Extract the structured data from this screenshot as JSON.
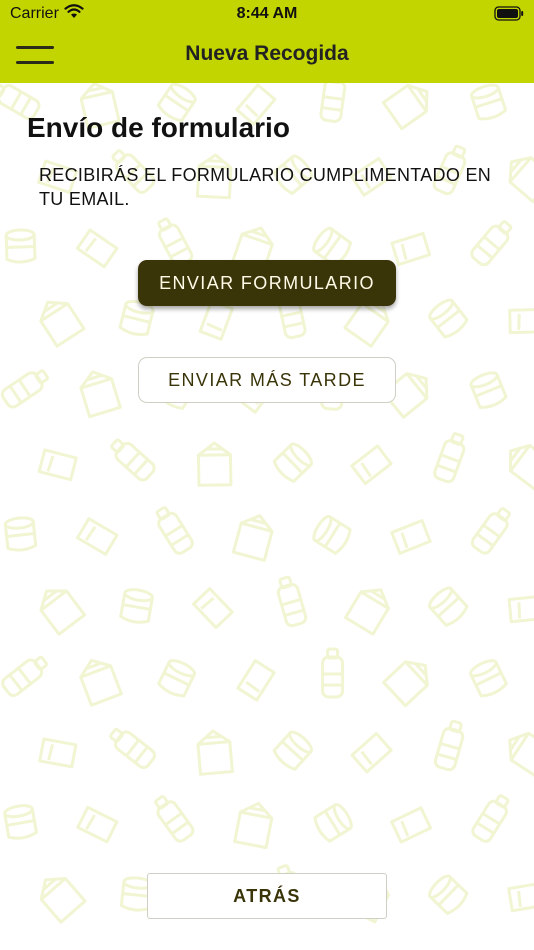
{
  "status_bar": {
    "carrier": "Carrier",
    "time": "8:44 AM"
  },
  "nav": {
    "title": "Nueva Recogida"
  },
  "content": {
    "title": "Envío de formulario",
    "description": "RECIBIRÁS EL FORMULARIO CUMPLIMENTADO EN TU EMAIL.",
    "send_label": "ENVIAR FORMULARIO",
    "later_label": "ENVIAR MÁS TARDE",
    "back_label": "ATRÁS"
  },
  "colors": {
    "header_bg": "#c3d500",
    "primary_button_bg": "#3a3409",
    "pattern_stroke": "#f3f6d9"
  },
  "icons": [
    "wifi-icon",
    "battery-icon",
    "menu-icon",
    "recycling-pattern"
  ]
}
